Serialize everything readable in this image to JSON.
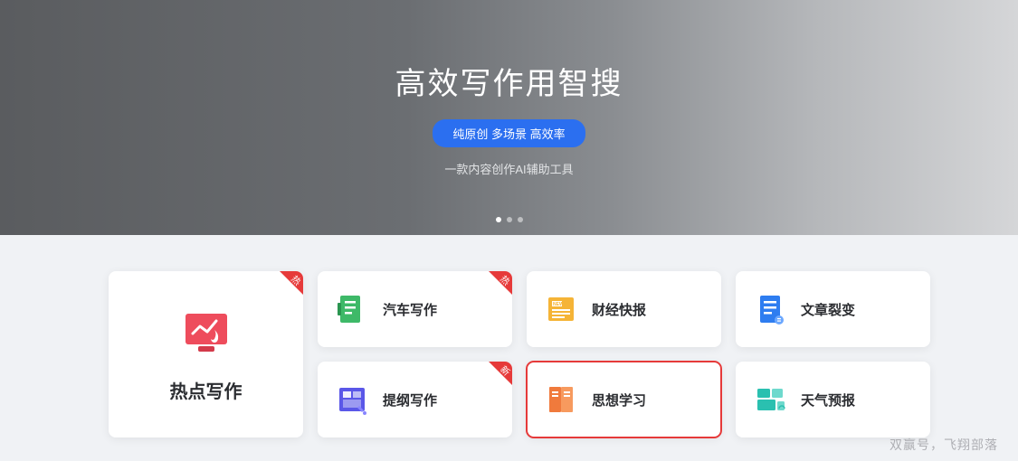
{
  "hero": {
    "title": "高效写作用智搜",
    "badge": "纯原创 多场景 高效率",
    "subtitle": "一款内容创作AI辅助工具"
  },
  "featured": {
    "label": "热点写作",
    "tag": "热"
  },
  "cards": [
    {
      "label": "汽车写作",
      "tag": "热"
    },
    {
      "label": "财经快报",
      "tag": ""
    },
    {
      "label": "文章裂变",
      "tag": ""
    },
    {
      "label": "提纲写作",
      "tag": "新"
    },
    {
      "label": "思想学习",
      "tag": ""
    },
    {
      "label": "天气预报",
      "tag": ""
    }
  ],
  "watermark": "双赢号，飞翔部落",
  "colors": {
    "accent_blue": "#2b6ff0",
    "tag_red": "#e63a3a",
    "highlight_index": 4
  }
}
